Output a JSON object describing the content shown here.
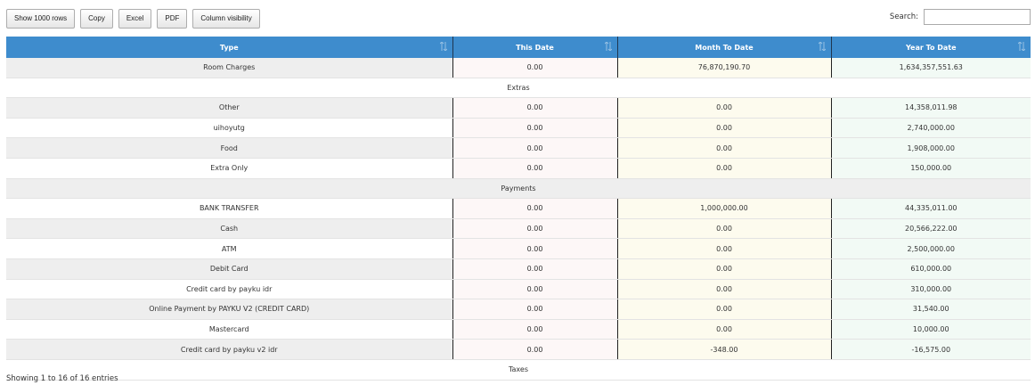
{
  "toolbar": {
    "buttons": [
      "Show 1000 rows",
      "Copy",
      "Excel",
      "PDF",
      "Column visibility"
    ]
  },
  "search": {
    "label": "Search:",
    "value": ""
  },
  "table": {
    "headers": [
      "Type",
      "This Date",
      "Month To Date",
      "Year To Date"
    ],
    "rows": [
      {
        "type": "Room Charges",
        "this": "0.00",
        "month": "76,870,190.70",
        "year": "1,634,357,551.63"
      },
      {
        "section": "Extras"
      },
      {
        "type": "Other",
        "this": "0.00",
        "month": "0.00",
        "year": "14,358,011.98"
      },
      {
        "type": "uihoyutg",
        "this": "0.00",
        "month": "0.00",
        "year": "2,740,000.00"
      },
      {
        "type": "Food",
        "this": "0.00",
        "month": "0.00",
        "year": "1,908,000.00"
      },
      {
        "type": "Extra Only",
        "this": "0.00",
        "month": "0.00",
        "year": "150,000.00"
      },
      {
        "section": "Payments"
      },
      {
        "type": "BANK TRANSFER",
        "this": "0.00",
        "month": "1,000,000.00",
        "year": "44,335,011.00"
      },
      {
        "type": "Cash",
        "this": "0.00",
        "month": "0.00",
        "year": "20,566,222.00"
      },
      {
        "type": "ATM",
        "this": "0.00",
        "month": "0.00",
        "year": "2,500,000.00"
      },
      {
        "type": "Debit Card",
        "this": "0.00",
        "month": "0.00",
        "year": "610,000.00"
      },
      {
        "type": "Credit card by payku idr",
        "this": "0.00",
        "month": "0.00",
        "year": "310,000.00"
      },
      {
        "type": "Online Payment by PAYKU V2 (CREDIT CARD)",
        "this": "0.00",
        "month": "0.00",
        "year": "31,540.00"
      },
      {
        "type": "Mastercard",
        "this": "0.00",
        "month": "0.00",
        "year": "10,000.00"
      },
      {
        "type": "Credit card by payku v2 idr",
        "this": "0.00",
        "month": "-348.00",
        "year": "-16,575.00"
      },
      {
        "section": "Taxes"
      }
    ]
  },
  "footer": {
    "info": "Showing 1 to 16 of 16 entries"
  },
  "colors": {
    "header_bg": "#3e8ccd",
    "this_date_bg": "#fdf7f7",
    "month_bg": "#fdfbee",
    "year_bg": "#f2faf5"
  }
}
